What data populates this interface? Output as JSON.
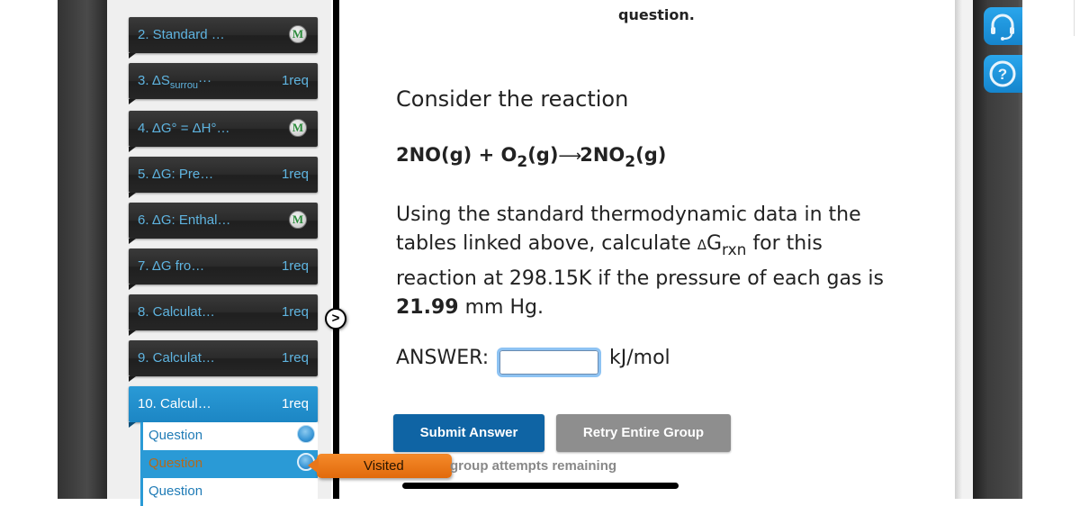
{
  "sidebar": {
    "items": [
      {
        "number": "2.",
        "label": "2. Standard …",
        "status": "M",
        "status_type": "badge"
      },
      {
        "number": "3.",
        "label_main": "3. ΔS",
        "label_sub": "surrou",
        "label_tail": "···",
        "status": "1req",
        "status_type": "text"
      },
      {
        "number": "4.",
        "label": "4. ΔG° = ΔH°…",
        "status": "M",
        "status_type": "badge"
      },
      {
        "number": "5.",
        "label": "5. ΔG: Pre…",
        "status": "1req",
        "status_type": "text"
      },
      {
        "number": "6.",
        "label": "6. ΔG: Enthal…",
        "status": "M",
        "status_type": "badge"
      },
      {
        "number": "7.",
        "label": "7. ΔG fro…",
        "status": "1req",
        "status_type": "text"
      },
      {
        "number": "8.",
        "label": "8. Calculat…",
        "status": "1req",
        "status_type": "text"
      },
      {
        "number": "9.",
        "label": "9. Calculat…",
        "status": "1req",
        "status_type": "text"
      },
      {
        "number": "10.",
        "label": "10. Calcul…",
        "status": "1req",
        "status_type": "text",
        "active": true
      }
    ],
    "sub_items": [
      {
        "label": "Question",
        "state": "normal"
      },
      {
        "label": "Question",
        "state": "current"
      },
      {
        "label": "Question",
        "state": "normal"
      }
    ],
    "expand_glyph": ">",
    "tooltip": "Visited"
  },
  "question": {
    "prev_text_end": "question.",
    "intro": "Consider the reaction",
    "equation": {
      "r1": "2NO(g) + O",
      "r1_sub": "2",
      "r1_tail": "(g)",
      "arrow": "⟶",
      "p1": "2NO",
      "p1_sub": "2",
      "p1_tail": "(g)"
    },
    "prompt": {
      "part1": "Using the standard thermodynamic data in the tables linked above, calculate ",
      "delta": "Δ",
      "G": "G",
      "G_sub": "rxn",
      "part2": " for this reaction at 298.15K if the pressure of each gas is ",
      "pressure_value": "21.99",
      "pressure_unit": " mm Hg."
    },
    "answer_label": "ANSWER:",
    "answer_value": "",
    "answer_unit": "kJ/mol"
  },
  "buttons": {
    "submit": "Submit Answer",
    "retry": "Retry Entire Group"
  },
  "attempts_text": "group attempts remaining",
  "colors": {
    "accent_blue": "#2a9ad6",
    "submit_blue": "#0f64a4",
    "retry_gray": "#8e8e8e",
    "tooltip_orange": "#f07a1a",
    "nav_text": "#5fb4e0"
  },
  "tools": [
    {
      "icon": "headset-icon",
      "label": "support"
    },
    {
      "icon": "help-icon",
      "label": "help"
    }
  ]
}
